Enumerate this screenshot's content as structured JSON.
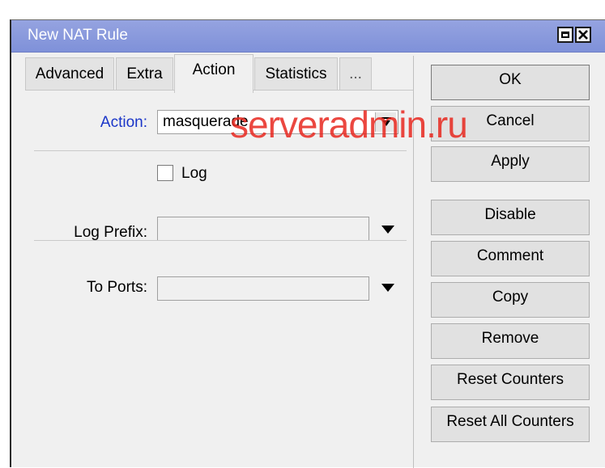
{
  "window": {
    "title": "New NAT Rule"
  },
  "tabs": [
    {
      "label": "Advanced"
    },
    {
      "label": "Extra"
    },
    {
      "label": "Action"
    },
    {
      "label": "Statistics"
    },
    {
      "label": "..."
    }
  ],
  "form": {
    "action_label": "Action:",
    "action_value": "masquerade",
    "log_label": "Log",
    "log_checked": false,
    "log_prefix_label": "Log Prefix:",
    "log_prefix_value": "",
    "to_ports_label": "To Ports:",
    "to_ports_value": ""
  },
  "buttons": {
    "ok": "OK",
    "cancel": "Cancel",
    "apply": "Apply",
    "disable": "Disable",
    "comment": "Comment",
    "copy": "Copy",
    "remove": "Remove",
    "reset_counters": "Reset Counters",
    "reset_all_counters": "Reset All Counters"
  },
  "watermark": "serveradmin.ru",
  "colors": {
    "titlebar": "#7f91d9",
    "action_label": "#1a35c8",
    "watermark": "#e8281f"
  }
}
